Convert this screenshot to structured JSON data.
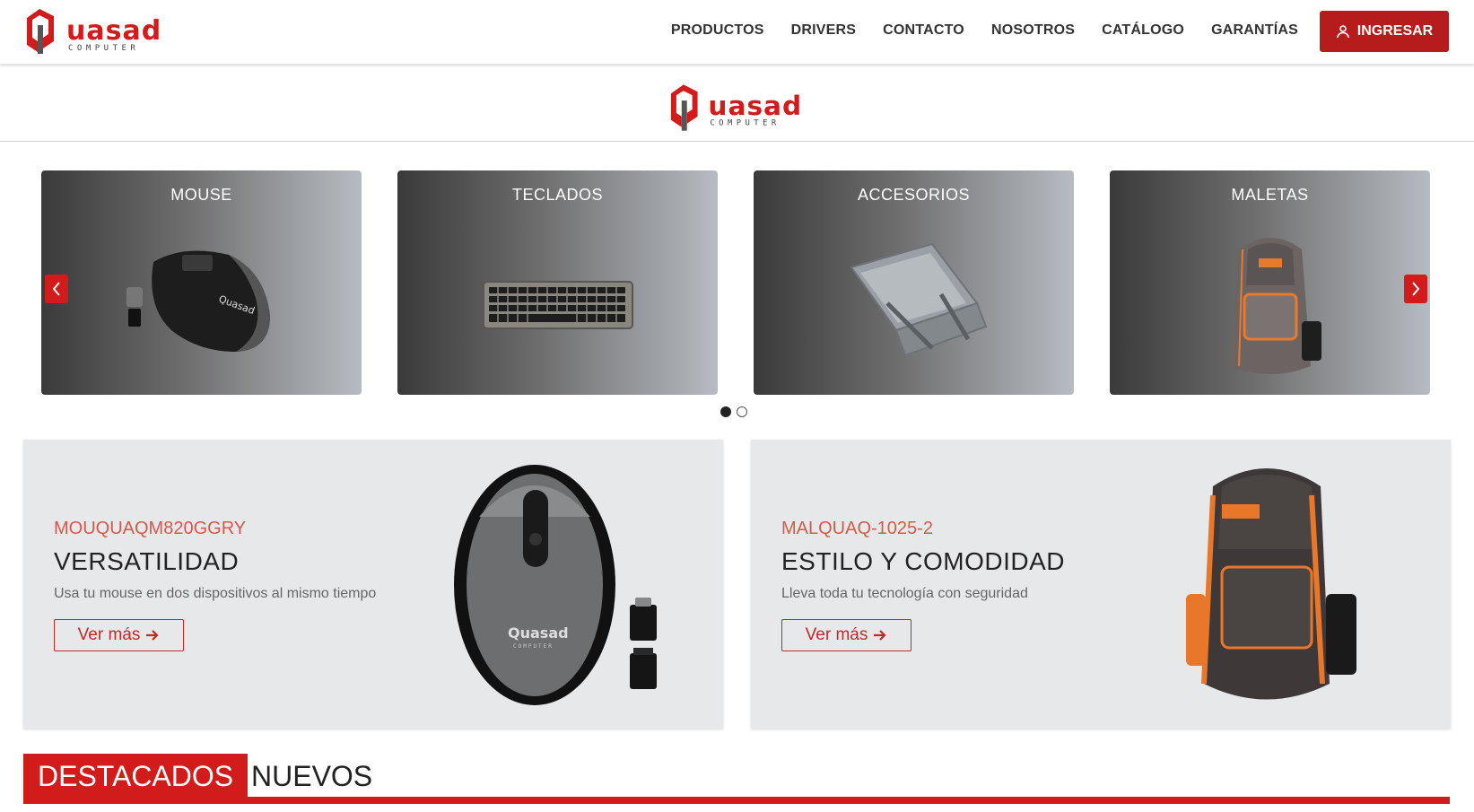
{
  "header": {
    "logo_alt": "Quasad Computer",
    "nav": [
      "PRODUCTOS",
      "DRIVERS",
      "CONTACTO",
      "NOSOTROS",
      "CATÁLOGO",
      "GARANTÍAS"
    ],
    "login_label": "INGRESAR"
  },
  "brand": {
    "logo_wordmark": "uasad",
    "logo_sub": "COMPUTER",
    "primary_color": "#d21c1c",
    "dark_red": "#b71c1c"
  },
  "carousel": {
    "categories": [
      {
        "label": "MOUSE",
        "icon": "mouse-product-image"
      },
      {
        "label": "TECLADOS",
        "icon": "keyboard-product-image"
      },
      {
        "label": "ACCESORIOS",
        "icon": "laptop-stand-product-image"
      },
      {
        "label": "MALETAS",
        "icon": "backpack-product-image"
      }
    ],
    "prev_icon": "chevron-left-icon",
    "next_icon": "chevron-right-icon",
    "page_count": 2,
    "active_page": 1
  },
  "promos": [
    {
      "code": "MOUQUAQM820GGRY",
      "title": "VERSATILIDAD",
      "description": "Usa tu mouse en dos dispositivos al mismo tiempo",
      "button_label": "Ver más",
      "image": "wireless-mouse-image"
    },
    {
      "code": "MALQUAQ-1025-2",
      "title": "ESTILO Y COMODIDAD",
      "description": "Lleva toda tu tecnología con seguridad",
      "button_label": "Ver más",
      "image": "backpack-image"
    }
  ],
  "tabs": [
    {
      "label": "DESTACADOS",
      "active": true
    },
    {
      "label": "NUEVOS",
      "active": false
    }
  ]
}
